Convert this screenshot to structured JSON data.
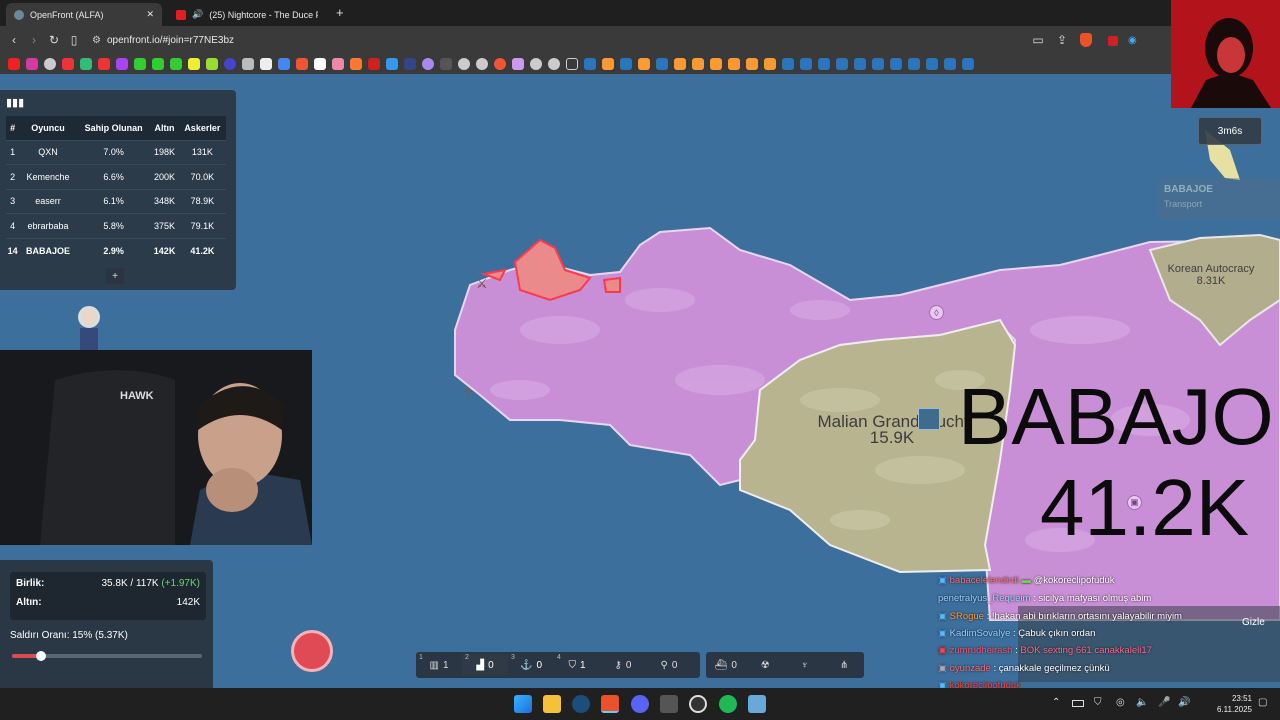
{
  "browser": {
    "tabs": [
      {
        "title": "OpenFront (ALFA)",
        "active": true
      },
      {
        "title": "(25) Nightcore - The Duce Puts O",
        "active": false
      }
    ],
    "url": "openfront.io/#join=r77NE3bz",
    "new_tab": "+"
  },
  "leaderboard": {
    "headers": [
      "#",
      "Oyuncu",
      "Sahip Olunan",
      "Altın",
      "Askerler"
    ],
    "rows": [
      {
        "rank": "1",
        "player": "QXN",
        "owned": "7.0%",
        "gold": "198K",
        "troops": "131K",
        "me": false
      },
      {
        "rank": "2",
        "player": "Kemenche",
        "owned": "6.6%",
        "gold": "200K",
        "troops": "70.0K",
        "me": false
      },
      {
        "rank": "3",
        "player": "easerr",
        "owned": "6.1%",
        "gold": "348K",
        "troops": "78.9K",
        "me": false
      },
      {
        "rank": "4",
        "player": "ebrarbaba",
        "owned": "5.8%",
        "gold": "375K",
        "troops": "79.1K",
        "me": false
      },
      {
        "rank": "14",
        "player": "BABAJOE",
        "owned": "2.9%",
        "gold": "142K",
        "troops": "41.2K",
        "me": true
      }
    ],
    "expand": "+"
  },
  "timer": "3m6s",
  "unit_info": {
    "name": "BABAJOE",
    "type": "Transport"
  },
  "map_labels": {
    "korea": {
      "name": "Korean Autocracy",
      "troops": "8.31K"
    },
    "mali": {
      "name": "Malian Grand Duchy",
      "troops": "15.9K"
    },
    "player": {
      "name": "BABAJO",
      "troops": "41.2K"
    }
  },
  "stats": {
    "units_label": "Birlik:",
    "units_value": "35.8K / 117K",
    "units_delta": "(+1.97K)",
    "gold_label": "Altın:",
    "gold_value": "142K",
    "attack_label": "Saldırı Oranı: 15% (5.37K)",
    "attack_ratio": 0.15
  },
  "build_bar": [
    {
      "key": "1",
      "count": "1"
    },
    {
      "key": "2",
      "count": "0"
    },
    {
      "key": "3",
      "count": "0"
    },
    {
      "key": "4",
      "count": "1"
    },
    {
      "key": "",
      "count": "0"
    },
    {
      "key": "",
      "count": "0"
    }
  ],
  "build_bar2": [
    {
      "count": "0"
    },
    {
      "count": ""
    },
    {
      "count": ""
    },
    {
      "count": ""
    }
  ],
  "chat": {
    "hide": "Gizle",
    "messages": [
      {
        "user": "babacelelendirdi",
        "text": "@kokoreclipofuduk",
        "color": "#ff6a6a"
      },
      {
        "user": "penetralyus_Requeim",
        "text": "sicilya mafyası olmuş abim",
        "color": "#9ad0ff"
      },
      {
        "user": "SRogue",
        "text": "!hakan abi bırıkların ortasını yalayabilir miyim",
        "color": "#ff9933"
      },
      {
        "user": "KadimSovalye",
        "text": "Çabuk çıkın ordan",
        "color": "#9ad0ff"
      },
      {
        "user": "zumrudheirash",
        "text": "BOK sexting 661 canakkaleli17",
        "color": "#ff4d6a"
      },
      {
        "user": "oyunzade",
        "text": "çanakkale geçilmez çünkü",
        "color": "#ff6a6a"
      },
      {
        "user": "kokoreclipofuduk",
        "text": "",
        "color": "#ff3b3b"
      }
    ]
  },
  "taskbar": {
    "time": "23:51",
    "date": "6.11.2025"
  },
  "webcam": {
    "chair_brand": "HAWK"
  }
}
